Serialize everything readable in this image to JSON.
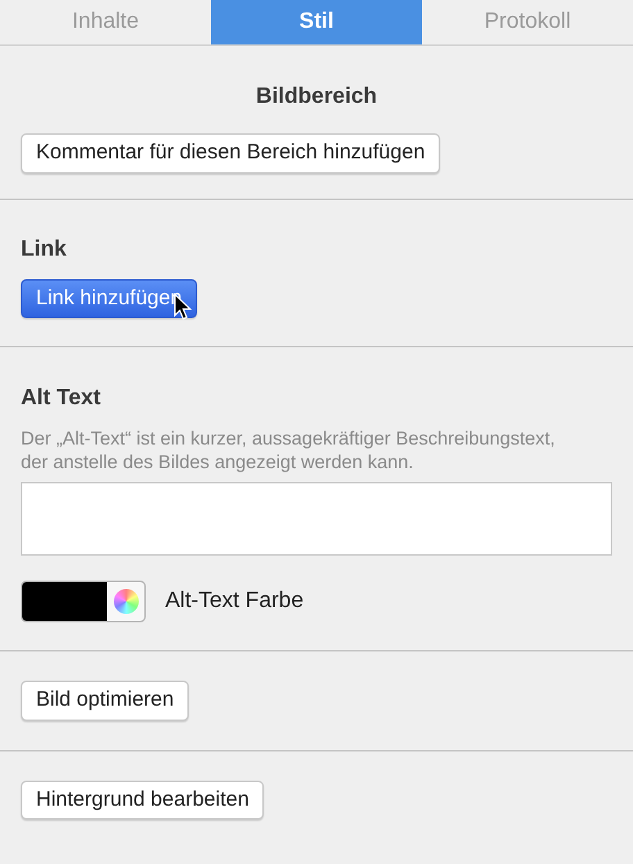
{
  "tabs": [
    {
      "label": "Inhalte",
      "selected": false
    },
    {
      "label": "Stil",
      "selected": true
    },
    {
      "label": "Protokoll",
      "selected": false
    }
  ],
  "image_area": {
    "title": "Bildbereich",
    "button": {
      "label": "Kommentar für diesen Bereich hinzufügen",
      "primary": false
    }
  },
  "link": {
    "title": "Link",
    "button": {
      "label": "Link hinzufügen",
      "primary": true
    }
  },
  "alt_text": {
    "title": "Alt Text",
    "description": "Der „Alt-Text“ ist ein kurzer, aussagekräftiger Beschreibungstext, der anstelle des Bildes angezeigt werden kann.",
    "color_well": {
      "color": "#000000",
      "label": "Alt-Text Farbe"
    }
  },
  "optimize": {
    "button": {
      "label": "Bild optimieren",
      "primary": false
    }
  },
  "background": {
    "button": {
      "label": "Hintergrund bearbeiten",
      "primary": false
    }
  }
}
